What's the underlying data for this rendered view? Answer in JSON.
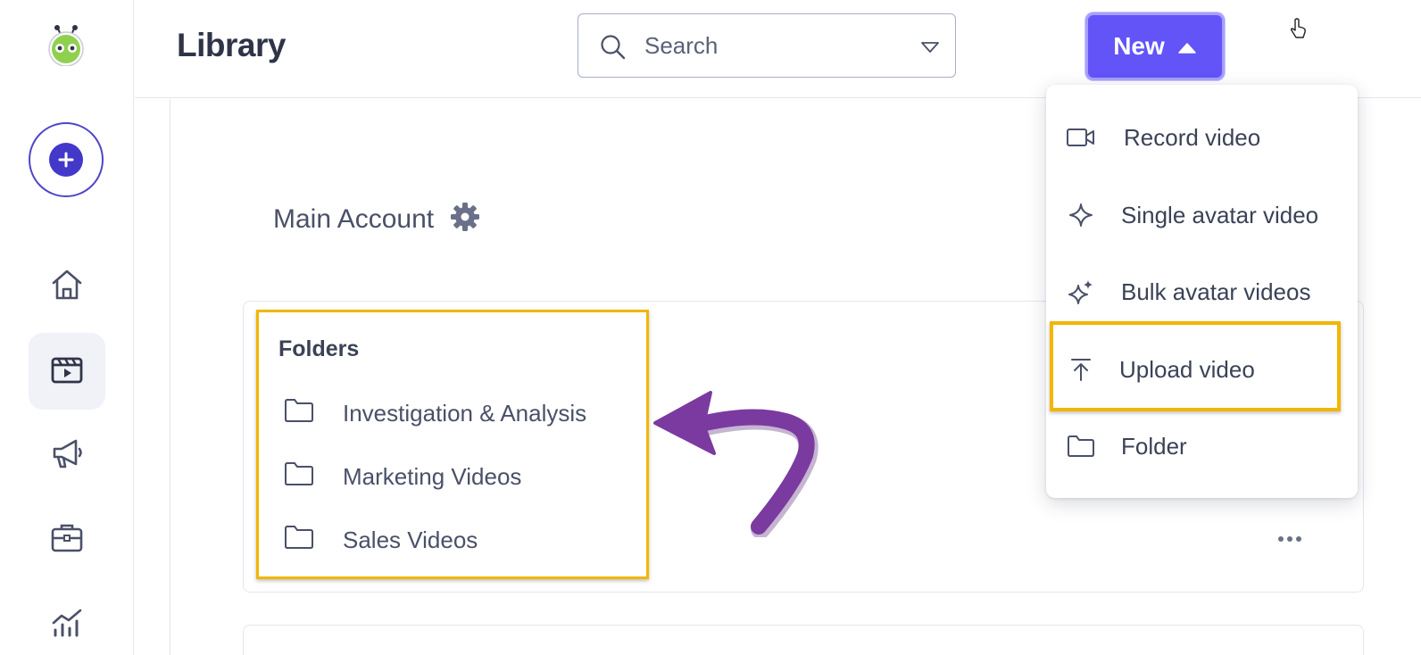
{
  "header": {
    "title": "Library",
    "search_placeholder": "Search",
    "new_button_label": "New"
  },
  "sidebar": {
    "items": [
      {
        "name": "create",
        "icon": "plus-icon"
      },
      {
        "name": "home",
        "icon": "home-icon"
      },
      {
        "name": "library",
        "icon": "video-library-icon",
        "active": true
      },
      {
        "name": "campaigns",
        "icon": "megaphone-icon"
      },
      {
        "name": "toolkit",
        "icon": "briefcase-icon"
      },
      {
        "name": "analytics",
        "icon": "chart-icon"
      }
    ]
  },
  "main": {
    "account_name": "Main Account",
    "folders_heading": "Folders",
    "folders": [
      {
        "label": "Investigation & Analysis"
      },
      {
        "label": "Marketing Videos"
      },
      {
        "label": "Sales Videos"
      }
    ]
  },
  "new_menu": {
    "items": [
      {
        "label": "Record video",
        "icon": "camera-icon"
      },
      {
        "label": "Single avatar video",
        "icon": "sparkle-icon"
      },
      {
        "label": "Bulk avatar videos",
        "icon": "sparkles-icon"
      },
      {
        "label": "Upload video",
        "icon": "upload-icon",
        "highlighted": true
      },
      {
        "label": "Folder",
        "icon": "folder-icon"
      }
    ]
  },
  "colors": {
    "accent": "#6254f7",
    "highlight": "#f2b600",
    "arrow": "#7b3aa0",
    "text": "#3b4257"
  }
}
